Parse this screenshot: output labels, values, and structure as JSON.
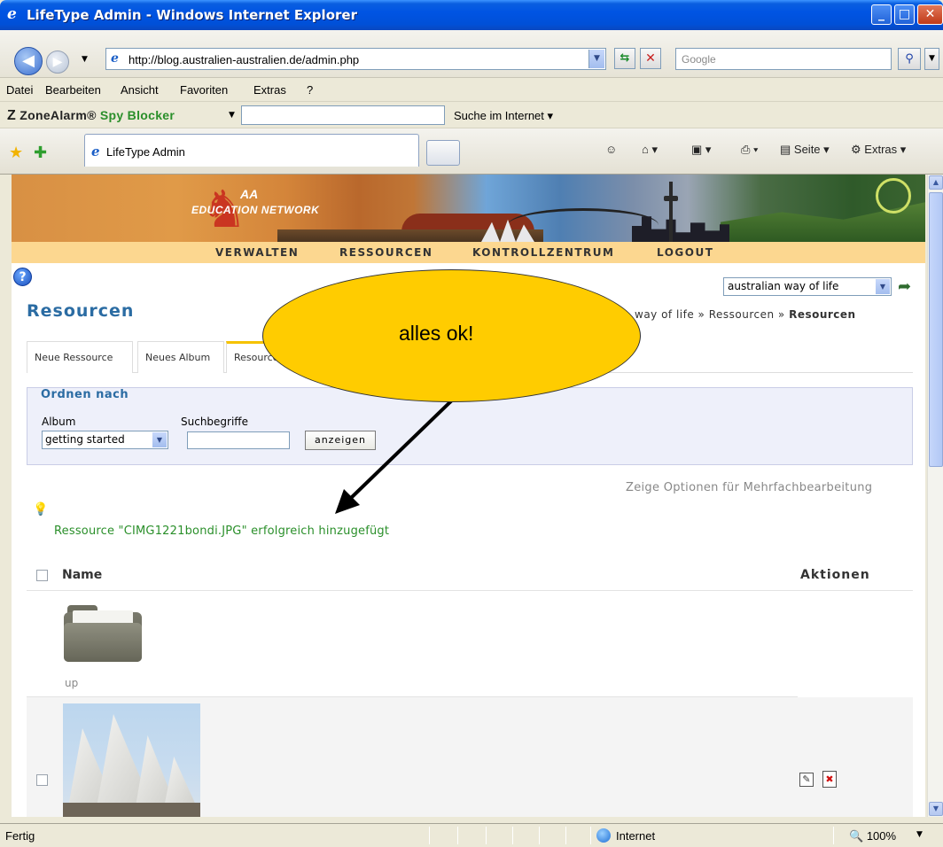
{
  "window": {
    "title": "LifeType Admin - Windows Internet Explorer",
    "minimize": "_",
    "maximize": "□",
    "close": "✕"
  },
  "address": {
    "url": "http://blog.australien-australien.de/admin.php",
    "search_placeholder": "Google"
  },
  "menu": [
    "Datei",
    "Bearbeiten",
    "Ansicht",
    "Favoriten",
    "Extras",
    "?"
  ],
  "zonealarm": {
    "logo_z": "Z",
    "logo_zone": "ZoneAlarm",
    "logo_spy": "Spy Blocker",
    "search_label": "Suche im Internet"
  },
  "tabs_browser": {
    "active_label": "LifeType Admin",
    "tools": {
      "page": "Seite",
      "extras": "Extras"
    }
  },
  "banner": {
    "logo_aa": "AA",
    "logo_text": "EDUCATION NETWORK"
  },
  "nav": [
    "VERWALTEN",
    "RESSOURCEN",
    "KONTROLLZENTRUM",
    "LOGOUT"
  ],
  "blog_select": "australian way of life",
  "page": {
    "title": "Resourcen",
    "breadcrumb_prefix": "way of life » Ressourcen » ",
    "breadcrumb_current": "Resourcen"
  },
  "content_tabs": [
    "Neue Ressource",
    "Neues Album",
    "Resourcen"
  ],
  "filter": {
    "legend": "Ordnen nach",
    "album_label": "Album",
    "keywords_label": "Suchbegriffe",
    "album_value": "getting started",
    "show_button": "anzeigen"
  },
  "multi_edit_link": "Zeige Optionen für Mehrfachbearbeitung",
  "success_message": "Ressource \"CIMG1221bondi.JPG\" erfolgreich hinzugefügt",
  "list": {
    "col_name": "Name",
    "col_actions": "Aktionen",
    "up_label": "up"
  },
  "callout": {
    "text": "alles ok!"
  },
  "status": {
    "text": "Fertig",
    "zone": "Internet",
    "zoom": "100%"
  },
  "colors": {
    "title_blue": "#2b6ca3",
    "success_green": "#2a8f2a",
    "callout_yellow": "#ffcc00",
    "nav_band": "#fcd790"
  }
}
